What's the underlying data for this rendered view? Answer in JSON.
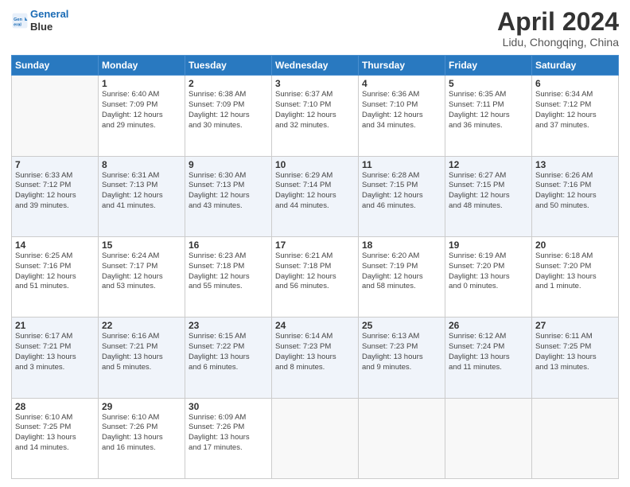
{
  "header": {
    "logo_line1": "General",
    "logo_line2": "Blue",
    "title": "April 2024",
    "subtitle": "Lidu, Chongqing, China"
  },
  "days_of_week": [
    "Sunday",
    "Monday",
    "Tuesday",
    "Wednesday",
    "Thursday",
    "Friday",
    "Saturday"
  ],
  "weeks": [
    [
      {
        "day": "",
        "info": ""
      },
      {
        "day": "1",
        "info": "Sunrise: 6:40 AM\nSunset: 7:09 PM\nDaylight: 12 hours\nand 29 minutes."
      },
      {
        "day": "2",
        "info": "Sunrise: 6:38 AM\nSunset: 7:09 PM\nDaylight: 12 hours\nand 30 minutes."
      },
      {
        "day": "3",
        "info": "Sunrise: 6:37 AM\nSunset: 7:10 PM\nDaylight: 12 hours\nand 32 minutes."
      },
      {
        "day": "4",
        "info": "Sunrise: 6:36 AM\nSunset: 7:10 PM\nDaylight: 12 hours\nand 34 minutes."
      },
      {
        "day": "5",
        "info": "Sunrise: 6:35 AM\nSunset: 7:11 PM\nDaylight: 12 hours\nand 36 minutes."
      },
      {
        "day": "6",
        "info": "Sunrise: 6:34 AM\nSunset: 7:12 PM\nDaylight: 12 hours\nand 37 minutes."
      }
    ],
    [
      {
        "day": "7",
        "info": "Sunrise: 6:33 AM\nSunset: 7:12 PM\nDaylight: 12 hours\nand 39 minutes."
      },
      {
        "day": "8",
        "info": "Sunrise: 6:31 AM\nSunset: 7:13 PM\nDaylight: 12 hours\nand 41 minutes."
      },
      {
        "day": "9",
        "info": "Sunrise: 6:30 AM\nSunset: 7:13 PM\nDaylight: 12 hours\nand 43 minutes."
      },
      {
        "day": "10",
        "info": "Sunrise: 6:29 AM\nSunset: 7:14 PM\nDaylight: 12 hours\nand 44 minutes."
      },
      {
        "day": "11",
        "info": "Sunrise: 6:28 AM\nSunset: 7:15 PM\nDaylight: 12 hours\nand 46 minutes."
      },
      {
        "day": "12",
        "info": "Sunrise: 6:27 AM\nSunset: 7:15 PM\nDaylight: 12 hours\nand 48 minutes."
      },
      {
        "day": "13",
        "info": "Sunrise: 6:26 AM\nSunset: 7:16 PM\nDaylight: 12 hours\nand 50 minutes."
      }
    ],
    [
      {
        "day": "14",
        "info": "Sunrise: 6:25 AM\nSunset: 7:16 PM\nDaylight: 12 hours\nand 51 minutes."
      },
      {
        "day": "15",
        "info": "Sunrise: 6:24 AM\nSunset: 7:17 PM\nDaylight: 12 hours\nand 53 minutes."
      },
      {
        "day": "16",
        "info": "Sunrise: 6:23 AM\nSunset: 7:18 PM\nDaylight: 12 hours\nand 55 minutes."
      },
      {
        "day": "17",
        "info": "Sunrise: 6:21 AM\nSunset: 7:18 PM\nDaylight: 12 hours\nand 56 minutes."
      },
      {
        "day": "18",
        "info": "Sunrise: 6:20 AM\nSunset: 7:19 PM\nDaylight: 12 hours\nand 58 minutes."
      },
      {
        "day": "19",
        "info": "Sunrise: 6:19 AM\nSunset: 7:20 PM\nDaylight: 13 hours\nand 0 minutes."
      },
      {
        "day": "20",
        "info": "Sunrise: 6:18 AM\nSunset: 7:20 PM\nDaylight: 13 hours\nand 1 minute."
      }
    ],
    [
      {
        "day": "21",
        "info": "Sunrise: 6:17 AM\nSunset: 7:21 PM\nDaylight: 13 hours\nand 3 minutes."
      },
      {
        "day": "22",
        "info": "Sunrise: 6:16 AM\nSunset: 7:21 PM\nDaylight: 13 hours\nand 5 minutes."
      },
      {
        "day": "23",
        "info": "Sunrise: 6:15 AM\nSunset: 7:22 PM\nDaylight: 13 hours\nand 6 minutes."
      },
      {
        "day": "24",
        "info": "Sunrise: 6:14 AM\nSunset: 7:23 PM\nDaylight: 13 hours\nand 8 minutes."
      },
      {
        "day": "25",
        "info": "Sunrise: 6:13 AM\nSunset: 7:23 PM\nDaylight: 13 hours\nand 9 minutes."
      },
      {
        "day": "26",
        "info": "Sunrise: 6:12 AM\nSunset: 7:24 PM\nDaylight: 13 hours\nand 11 minutes."
      },
      {
        "day": "27",
        "info": "Sunrise: 6:11 AM\nSunset: 7:25 PM\nDaylight: 13 hours\nand 13 minutes."
      }
    ],
    [
      {
        "day": "28",
        "info": "Sunrise: 6:10 AM\nSunset: 7:25 PM\nDaylight: 13 hours\nand 14 minutes."
      },
      {
        "day": "29",
        "info": "Sunrise: 6:10 AM\nSunset: 7:26 PM\nDaylight: 13 hours\nand 16 minutes."
      },
      {
        "day": "30",
        "info": "Sunrise: 6:09 AM\nSunset: 7:26 PM\nDaylight: 13 hours\nand 17 minutes."
      },
      {
        "day": "",
        "info": ""
      },
      {
        "day": "",
        "info": ""
      },
      {
        "day": "",
        "info": ""
      },
      {
        "day": "",
        "info": ""
      }
    ]
  ]
}
